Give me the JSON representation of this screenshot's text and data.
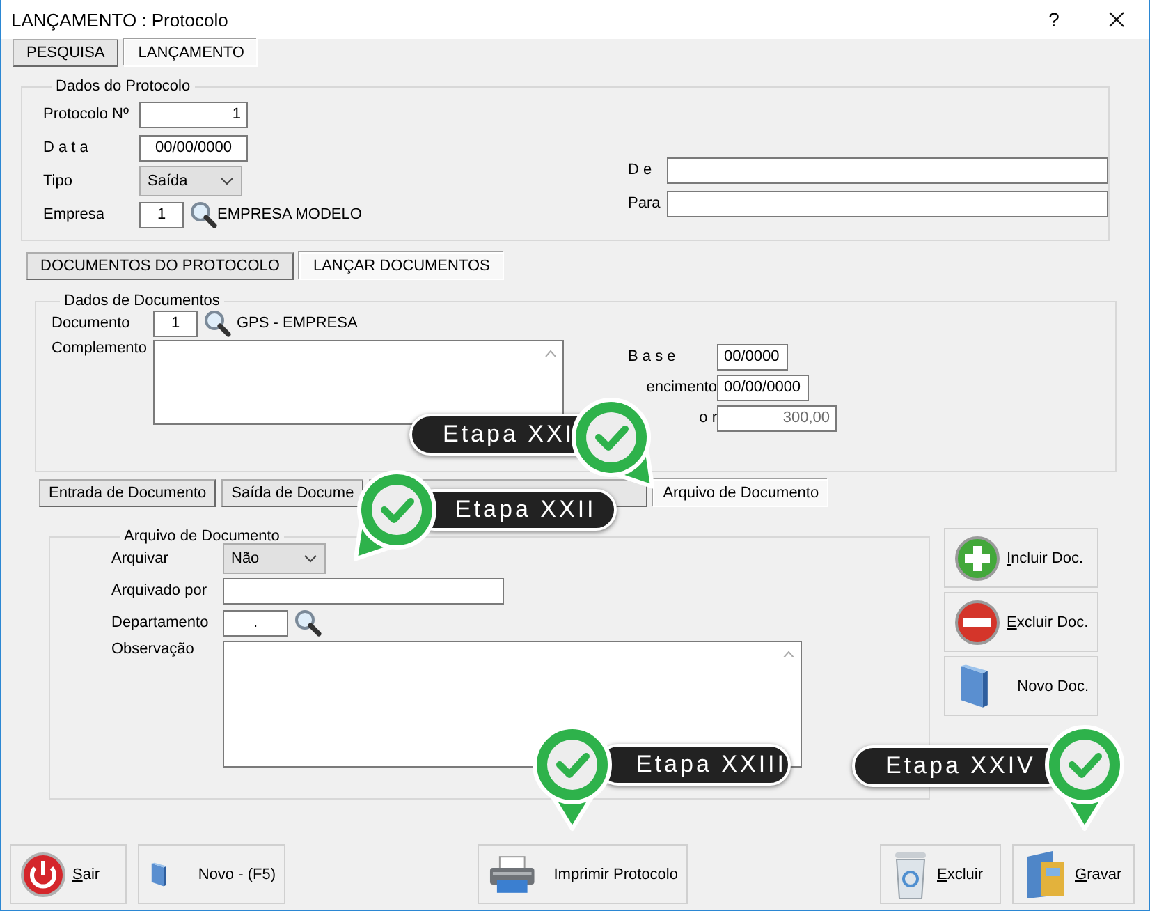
{
  "window": {
    "title": "LANÇAMENTO : Protocolo",
    "help": "?"
  },
  "main_tabs": [
    {
      "label": "PESQUISA",
      "selected": false
    },
    {
      "label": "LANÇAMENTO",
      "selected": true
    }
  ],
  "protocolo": {
    "legend": "Dados do Protocolo",
    "fields": [
      {
        "label": "Protocolo Nº",
        "value": "1",
        "kind": "number"
      },
      {
        "label": "D a t a",
        "value": "00/00/0000",
        "kind": "date"
      },
      {
        "label": "Tipo",
        "value": "Saída",
        "kind": "select"
      },
      {
        "label": "Empresa",
        "value": "1",
        "kind": "lookup",
        "lookup_text": "EMPRESA MODELO"
      }
    ],
    "right_fields": [
      {
        "label": "D e"
      },
      {
        "label": "Para"
      }
    ]
  },
  "doc_tabs": [
    {
      "label": "DOCUMENTOS DO PROTOCOLO",
      "selected": false
    },
    {
      "label": "LANÇAR DOCUMENTOS",
      "selected": true
    }
  ],
  "documentos": {
    "legend": "Dados de Documentos",
    "documento": {
      "label": "Documento",
      "value": "1",
      "lookup_text": "GPS - EMPRESA"
    },
    "complemento": {
      "label": "Complemento"
    },
    "right_fields": [
      {
        "label": "B a s e",
        "value": "00/0000",
        "disabled": false
      },
      {
        "label": "encimento",
        "value": "00/00/0000",
        "disabled": false
      },
      {
        "label": "o r",
        "value": "300,00",
        "disabled": true
      }
    ]
  },
  "sub_tabs": [
    {
      "label": "Entrada de Documento",
      "selected": false
    },
    {
      "label": "Saída de Docume",
      "selected": false
    },
    {
      "selected": false
    },
    {
      "label": "Arquivo de Documento",
      "selected": true
    }
  ],
  "arquivo": {
    "legend": "Arquivo de Documento",
    "fields": [
      {
        "label": "Arquivar",
        "value": "Não",
        "kind": "select"
      },
      {
        "label": "Arquivado por",
        "kind": "text"
      },
      {
        "label": "Departamento",
        "value": ".",
        "kind": "lookup"
      },
      {
        "label": "Observação",
        "kind": "memo"
      }
    ]
  },
  "side_buttons": [
    {
      "label": "Incluir Doc.",
      "kind": "plus",
      "mnemonic": true
    },
    {
      "label": "Excluir Doc.",
      "kind": "minus",
      "mnemonic": true
    },
    {
      "label": "Novo Doc.",
      "kind": "book",
      "mnemonic": false
    }
  ],
  "bottom_buttons": [
    {
      "label": "Sair",
      "kind": "power",
      "mnemonic": true
    },
    {
      "label": "Novo - (F5)",
      "kind": "book",
      "mnemonic": false
    },
    {
      "label": "Imprimir Protocolo",
      "kind": "printer",
      "mnemonic": false
    },
    {
      "label": "Excluir",
      "kind": "trash",
      "mnemonic": true
    },
    {
      "label": "Gravar",
      "kind": "folder",
      "mnemonic": true
    }
  ],
  "callouts": [
    {
      "label": "Etapa XXI"
    },
    {
      "label": "Etapa XXII"
    },
    {
      "label": "Etapa XXIII"
    },
    {
      "label": "Etapa XXIV"
    }
  ]
}
